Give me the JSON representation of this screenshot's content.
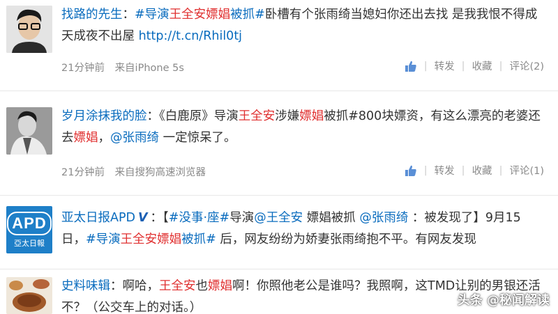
{
  "posts": [
    {
      "username": "找路的先生",
      "sep": "：",
      "segments": [
        {
          "t": "#导演",
          "c": "link"
        },
        {
          "t": "王全安",
          "c": "red"
        },
        {
          "t": "嫖娼",
          "c": "red"
        },
        {
          "t": "被抓#",
          "c": "link"
        },
        {
          "t": "卧槽有个张雨绮当媳妇你还出去找 是我我恨不得成天成夜不出屋 ",
          "c": ""
        },
        {
          "t": "http://t.cn/Rhil0tj",
          "c": "link"
        }
      ],
      "time": "21分钟前",
      "source": "来自iPhone 5s",
      "actions": [
        "转发",
        "收藏",
        "评论(2)"
      ]
    },
    {
      "username": "岁月涂抹我的脸",
      "sep": "：",
      "segments": [
        {
          "t": "《白鹿原》导演",
          "c": ""
        },
        {
          "t": "王全安",
          "c": "red"
        },
        {
          "t": "涉嫌",
          "c": ""
        },
        {
          "t": "嫖娼",
          "c": "red"
        },
        {
          "t": "被抓#800块嫖资，有这么漂亮的老婆还去",
          "c": ""
        },
        {
          "t": "嫖娼",
          "c": "red"
        },
        {
          "t": "，",
          "c": ""
        },
        {
          "t": "@张雨绮",
          "c": "link"
        },
        {
          "t": " 一定惊呆了。",
          "c": ""
        }
      ],
      "time": "21分钟前",
      "source": "来自搜狗高速浏览器",
      "actions": [
        "转发",
        "收藏",
        "评论(1)"
      ]
    },
    {
      "username": "亚太日报APD",
      "badge": "V",
      "sep": "：",
      "segments": [
        {
          "t": "【",
          "c": ""
        },
        {
          "t": "#没事·座#",
          "c": "link"
        },
        {
          "t": "导演",
          "c": ""
        },
        {
          "t": "@王全安",
          "c": "link"
        },
        {
          "t": " 嫖娼被抓 ",
          "c": ""
        },
        {
          "t": "@张雨绮",
          "c": "link"
        },
        {
          "t": " ：被发现了】9月15日，",
          "c": ""
        },
        {
          "t": "#导演",
          "c": "link"
        },
        {
          "t": "王全安",
          "c": "red"
        },
        {
          "t": "嫖娼",
          "c": "red"
        },
        {
          "t": "被抓#",
          "c": "link"
        },
        {
          "t": " 后，网友纷纷为娇妻张雨绮抱不平。有网友发现",
          "c": ""
        }
      ],
      "avatar_text": "APD",
      "avatar_sub": "亞太日報"
    },
    {
      "username": "史料味辑",
      "sep": "：",
      "segments": [
        {
          "t": "啊哈，",
          "c": ""
        },
        {
          "t": "王全安",
          "c": "red"
        },
        {
          "t": "也",
          "c": ""
        },
        {
          "t": "嫖娼",
          "c": "red"
        },
        {
          "t": "啊！你照他老公是谁吗？我照啊，这TMD让别的男银还活不？（公交车上的对话。）",
          "c": ""
        }
      ]
    }
  ],
  "watermark": "头条 @秘闻解读",
  "colors": {
    "link": "#0a6cbe",
    "red": "#e03030",
    "meta": "#8a8a8a"
  }
}
